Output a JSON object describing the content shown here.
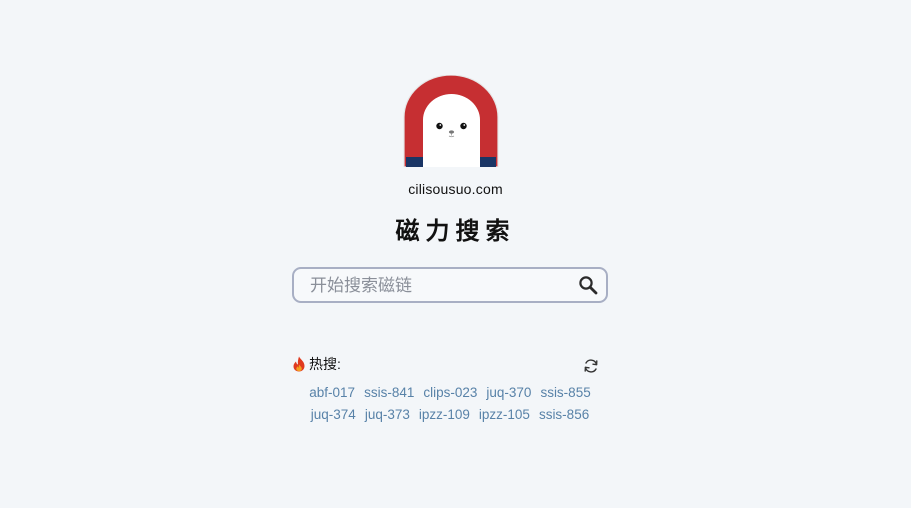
{
  "site": {
    "domain": "cilisousuo.com",
    "title": "磁力搜索"
  },
  "search": {
    "placeholder": "开始搜索磁链",
    "value": ""
  },
  "hot": {
    "label": "热搜:",
    "rows": [
      [
        "abf-017",
        "ssis-841",
        "clips-023",
        "juq-370",
        "ssis-855"
      ],
      [
        "juq-374",
        "juq-373",
        "ipzz-109",
        "ipzz-105",
        "ssis-856"
      ]
    ]
  },
  "colors": {
    "background": "#f3f6f9",
    "link": "#5882a8",
    "magnet_red": "#c62f32",
    "magnet_blue": "#1a3565",
    "search_border": "#a8afc4"
  },
  "icons": {
    "logo": "magnet-seal-logo",
    "search": "search-icon",
    "fire": "fire-icon",
    "refresh": "refresh-icon"
  }
}
